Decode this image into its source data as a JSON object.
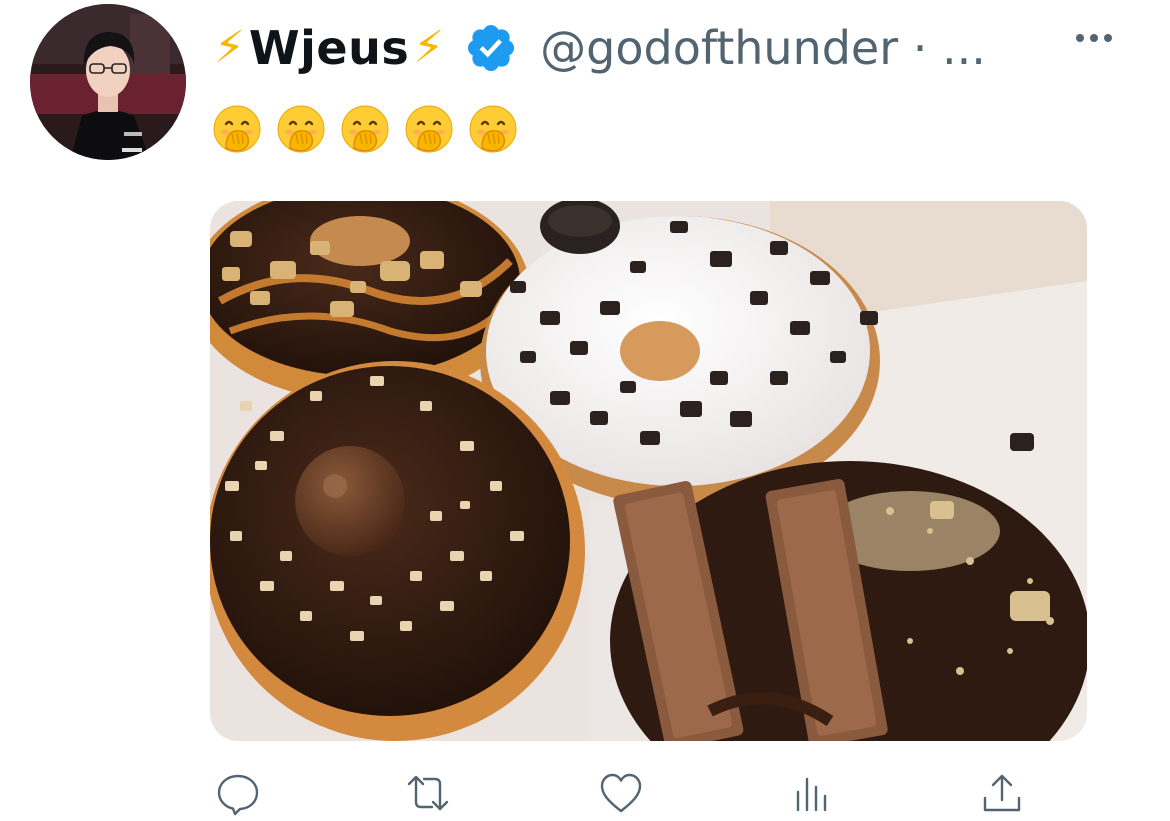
{
  "tweet": {
    "author": {
      "bolt_left": "⚡",
      "display_name": "Wjeus",
      "bolt_right": "⚡",
      "verified": true,
      "handle_line": "@godofthunder · ..."
    },
    "text_emojis": [
      "🤭",
      "🤭",
      "🤭",
      "🤭",
      "🤭"
    ],
    "actions": [
      "reply-icon",
      "retweet-icon",
      "like-icon",
      "analytics-icon",
      "share-icon"
    ]
  },
  "colors": {
    "verified_blue": "#1d9bf0",
    "secondary_text": "#536471",
    "bolt_yellow": "#f5b800"
  }
}
